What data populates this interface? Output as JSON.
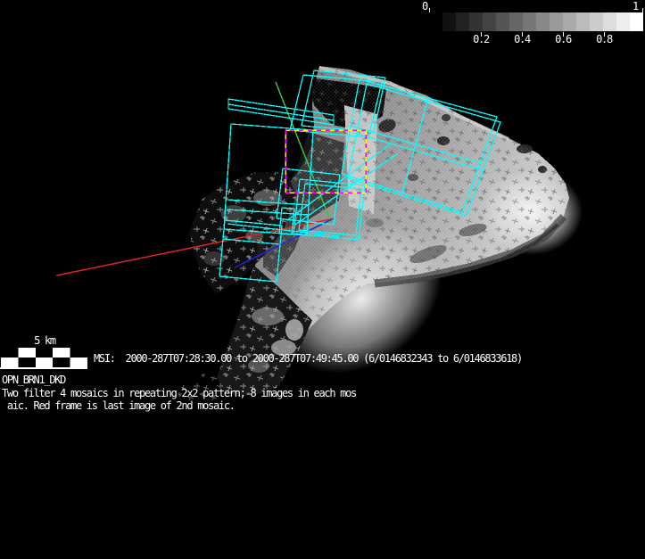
{
  "window": {
    "background": "#000000"
  },
  "colorbar": {
    "min_label": "0",
    "max_label": "1",
    "tick_labels": [
      "0.2",
      "0.4",
      "0.6",
      "0.8"
    ],
    "range": [
      0,
      1
    ],
    "steps": 16
  },
  "scalebar": {
    "label": "5 km"
  },
  "status": {
    "instrument_line": "MSI:  2000-287T07:28:30.00 to 2000-287T07:49:45.00 (6/0146832343 to 6/0146833618)"
  },
  "sequence": {
    "name": "OPN_BRN1_DKD"
  },
  "caption": {
    "line1": "Two filter 4 mosaics in repeating 2x2 pattern; 8 images in each mos",
    "line2": " aic. Red frame is last image of 2nd mosaic."
  },
  "legend_colors": {
    "image_footprint": "#00ffff",
    "last_frame_dash_a": "#ffff00",
    "last_frame_dash_b": "#ff00ff",
    "axis_red": "#dd2222",
    "axis_green": "#3fbf3f",
    "axis_blue": "#2222dd"
  }
}
